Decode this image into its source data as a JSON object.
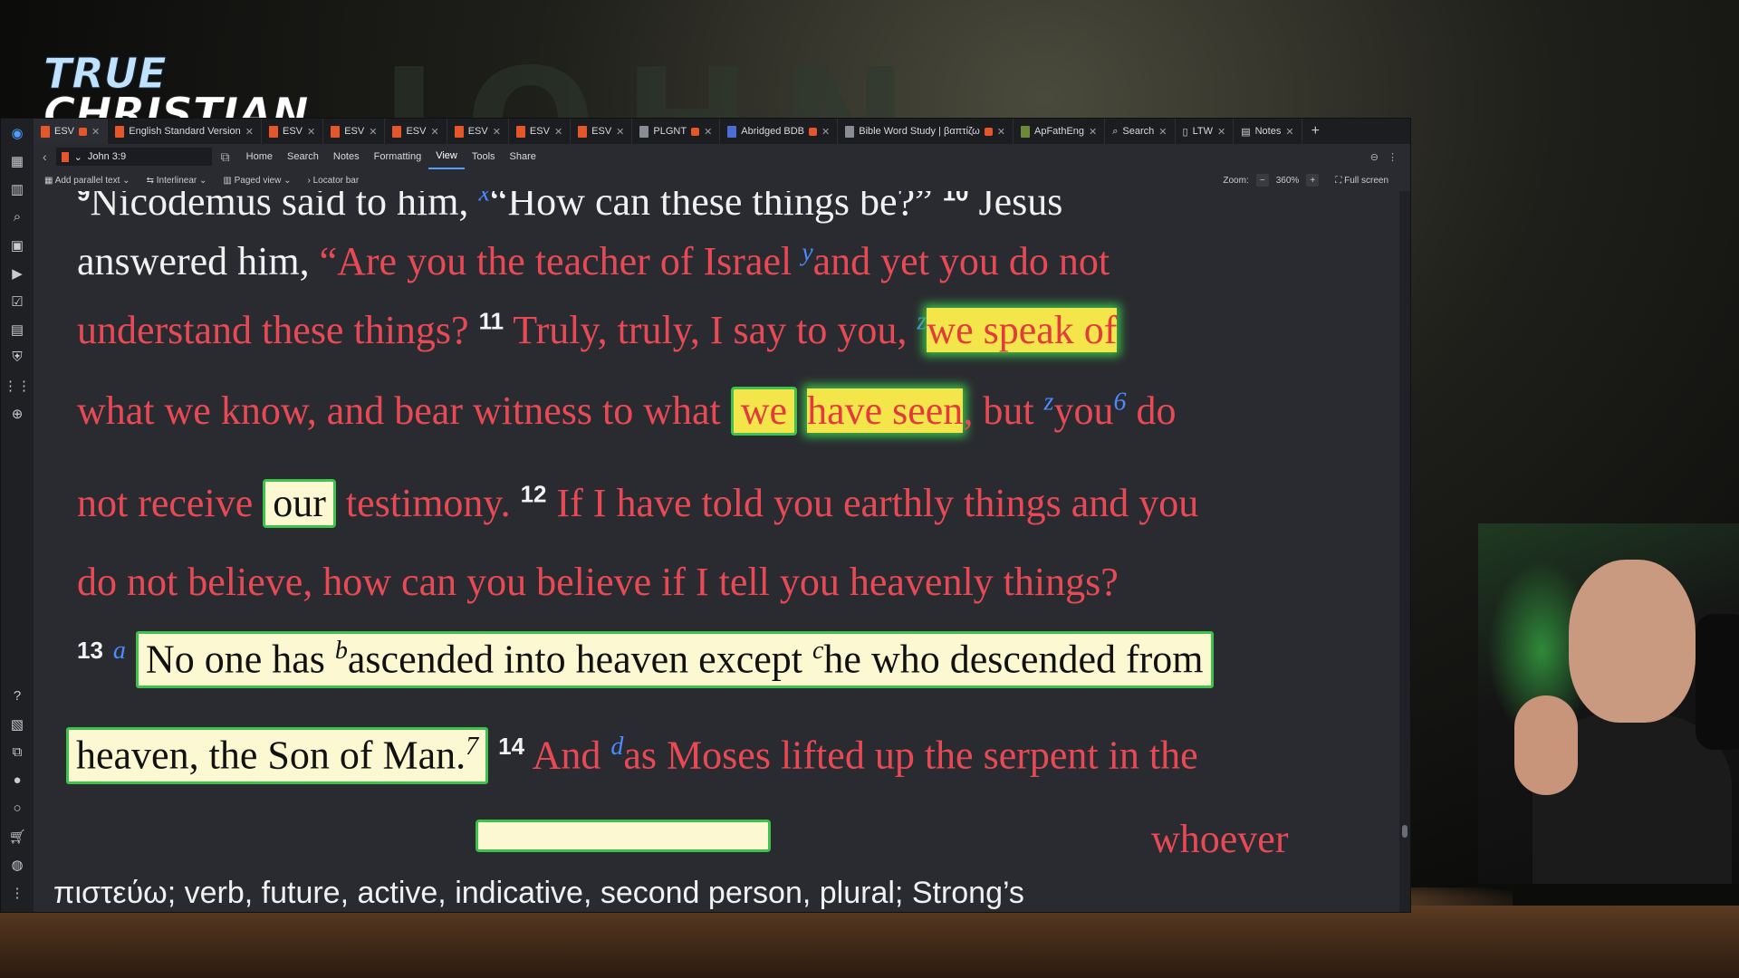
{
  "brand": {
    "line1": "TRUE",
    "line2": "CHRISTIAN"
  },
  "tabs": [
    {
      "label": "ESV",
      "icon": "book-icon",
      "active": true
    },
    {
      "label": "English Standard Version",
      "icon": "book-icon"
    },
    {
      "label": "ESV",
      "icon": "book-icon"
    },
    {
      "label": "ESV",
      "icon": "book-icon"
    },
    {
      "label": "ESV",
      "icon": "book-icon"
    },
    {
      "label": "ESV",
      "icon": "book-icon"
    },
    {
      "label": "ESV",
      "icon": "book-icon"
    },
    {
      "label": "ESV",
      "icon": "book-icon"
    },
    {
      "label": "PLGNT",
      "icon": "book-icon"
    },
    {
      "label": "Abridged BDB",
      "icon": "book-icon"
    },
    {
      "label": "Bible Word Study | βαπτίζω",
      "icon": "study-icon"
    },
    {
      "label": "ApFathEng",
      "icon": "book-icon"
    },
    {
      "label": "Search",
      "icon": "search-icon"
    },
    {
      "label": "LTW",
      "icon": "document-icon"
    },
    {
      "label": "Notes",
      "icon": "notes-icon"
    }
  ],
  "toolbar": {
    "reference": "John 3:9",
    "menu": [
      "Home",
      "Search",
      "Notes",
      "Formatting",
      "View",
      "Tools",
      "Share"
    ],
    "active_menu": "View"
  },
  "subbar": {
    "parallel": "Add parallel text",
    "interlinear": "Interlinear",
    "paged": "Paged view",
    "locator": "Locator bar",
    "zoom_label": "Zoom:",
    "zoom_value": "360%",
    "fullscreen": "Full screen"
  },
  "text": {
    "l1_vnum": "9",
    "l1_a": "Nicodemus said to him, ",
    "l1_fn": "x",
    "l1_b": "“How can these things be?” ",
    "l1_vnum2": "10",
    "l1_c": " Jesus",
    "l2_a": "answered him, ",
    "l2_b": "“Are you the teacher of Israel ",
    "l2_fn": "y",
    "l2_c": "and yet you do not",
    "l3_a": "understand these things? ",
    "l3_vnum": "11",
    "l3_b": " Truly, truly, I say to you, ",
    "l3_fn": "z",
    "l3_hl": "we speak of",
    "l4_a": "what we know, and bear witness to what ",
    "l4_hl1": "we",
    "l4_hl2": "have seen",
    "l4_b": ", but ",
    "l4_fn": "z",
    "l4_c": "you",
    "l4_fn2": "6",
    "l4_d": " do",
    "l5_a": "not receive ",
    "l5_hl": "our",
    "l5_b": " testimony. ",
    "l5_vnum": "12",
    "l5_c": " If I have told you earthly things and you",
    "l6_a": "do not believe, how can you believe if I tell you heavenly things?",
    "l7_vnum": "13",
    "l7_fn": "a",
    "l7_hl_a": "No one has ",
    "l7_fn2": "b",
    "l7_hl_b": "ascended into heaven except ",
    "l7_fn3": "c",
    "l7_hl_c": "he who descended from",
    "l8_hl": "heaven, the Son of Man.",
    "l8_fn": "7",
    "l8_vnum": "14",
    "l8_a": " And ",
    "l8_fn2": "d",
    "l8_b": "as Moses lifted up the serpent in the",
    "l9_partial": "whoever"
  },
  "status": "πιστεύω; verb, future, active, indicative, second person, plural; Strong’s",
  "colors": {
    "red_text": "#e84a55",
    "footnote": "#4a8cff",
    "highlight_green": "#3cc24d",
    "highlight_yellow": "#f6e23c"
  }
}
